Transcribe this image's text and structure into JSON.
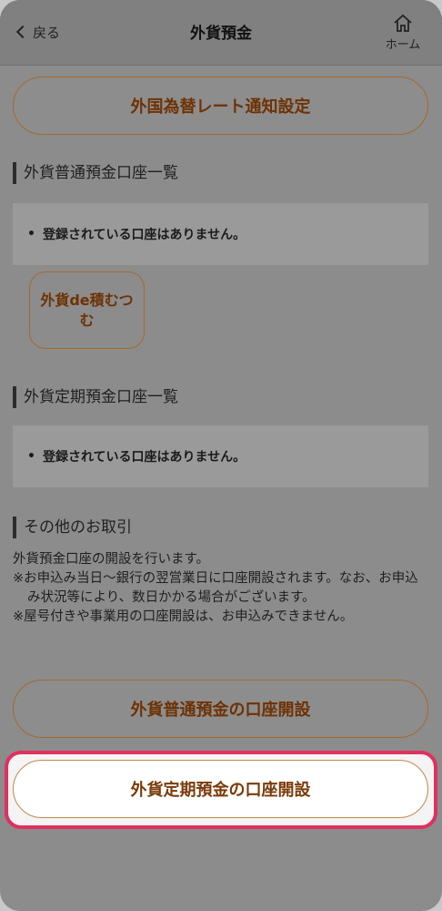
{
  "header": {
    "back_label": "戻る",
    "title": "外貨預金",
    "home_label": "ホーム"
  },
  "buttons": {
    "rate_notification": "外国為替レート通知設定",
    "gaika_de_tsumitatsu": "外貨de積むつむ",
    "open_ordinary": "外貨普通預金の口座開設",
    "open_time_deposit": "外貨定期預金の口座開設"
  },
  "sections": {
    "ordinary_list_title": "外貨普通預金口座一覧",
    "ordinary_empty": "登録されている口座はありません。",
    "time_list_title": "外貨定期預金口座一覧",
    "time_empty": "登録されている口座はありません。",
    "other_title": "その他のお取引"
  },
  "description": {
    "line1": "外貨預金口座の開設を行います。",
    "note1": "※お申込み当日〜銀行の翌営業日に口座開設されます。なお、お申込み状況等により、数日かかる場合がございます。",
    "note2": "※屋号付きや事業用の口座開設は、お申込みできません。"
  },
  "colors": {
    "accent_text": "#6e3204",
    "button_border": "#a36a2e",
    "focus_ring": "#e0305f",
    "overlay_bg": "#8c8c8c"
  }
}
